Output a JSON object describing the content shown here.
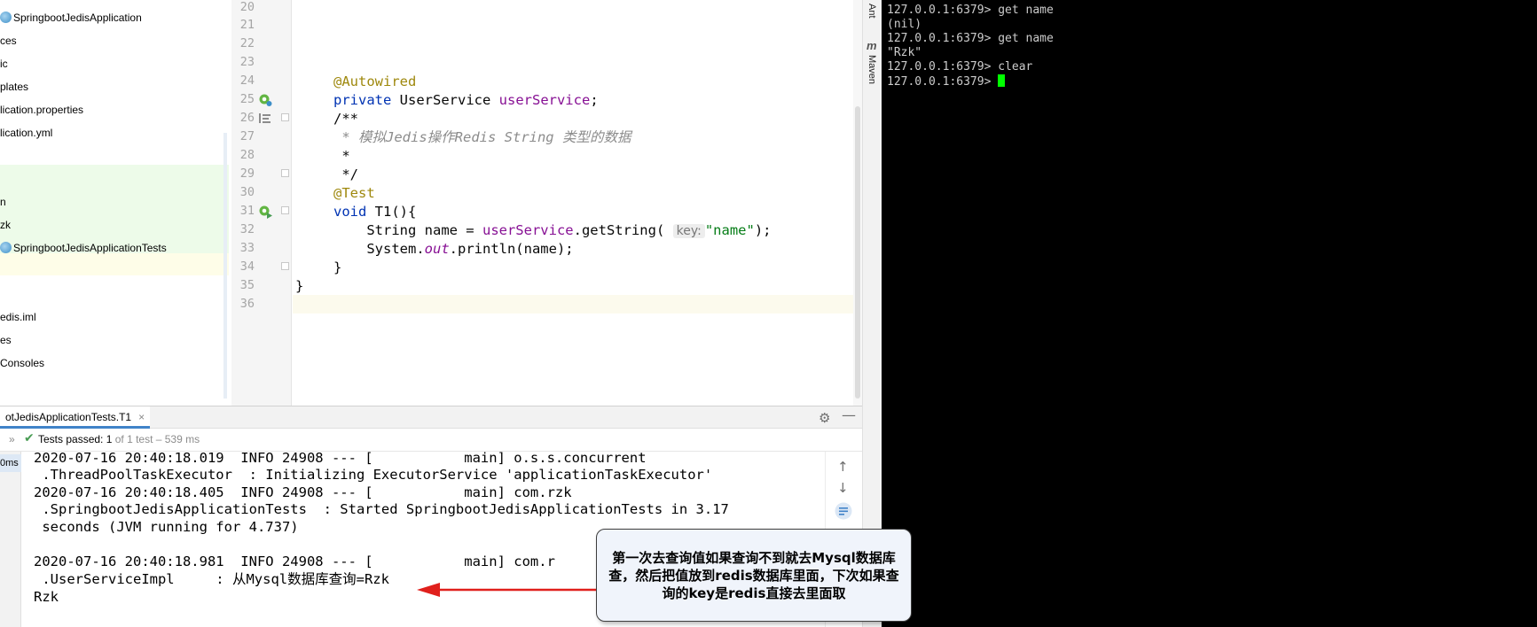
{
  "project_tree": {
    "items": [
      {
        "label": "SpringbootJedisApplication",
        "icon": "spring-class-icon"
      },
      {
        "label": "ces",
        "icon": ""
      },
      {
        "label": "ic",
        "icon": ""
      },
      {
        "label": "plates",
        "icon": ""
      },
      {
        "label": "lication.properties",
        "icon": ""
      },
      {
        "label": "lication.yml",
        "icon": ""
      },
      {
        "label": "",
        "icon": ""
      },
      {
        "label": "",
        "icon": ""
      },
      {
        "label": "n",
        "icon": ""
      },
      {
        "label": "zk",
        "icon": ""
      },
      {
        "label": "SpringbootJedisApplicationTests",
        "icon": "spring-test-class-icon"
      },
      {
        "label": "",
        "icon": ""
      },
      {
        "label": "",
        "icon": ""
      },
      {
        "label": "",
        "icon": ""
      },
      {
        "label": "edis.iml",
        "icon": ""
      },
      {
        "label": "es",
        "icon": ""
      },
      {
        "label": "Consoles",
        "icon": ""
      }
    ]
  },
  "editor": {
    "line_numbers": [
      "20",
      "21",
      "22",
      "23",
      "24",
      "25",
      "26",
      "27",
      "28",
      "29",
      "30",
      "31",
      "32",
      "33",
      "34",
      "35",
      "36"
    ],
    "code": {
      "l24_annotation": "@Autowired",
      "l25_kw": "private",
      "l25_type": " UserService ",
      "l25_field": "userService",
      "l25_end": ";",
      "l26": "/**",
      "l27_star": " * ",
      "l27_text": "模拟Jedis操作Redis String 类型的数据",
      "l28": " *",
      "l29": " */",
      "l30_annotation": "@Test",
      "l31_kw": "void",
      "l31_rest": " T1(){",
      "l32_indent": "    String name = ",
      "l32_field": "userService",
      "l32_call": ".getString( ",
      "l32_hint": "key:",
      "l32_str": "\"name\"",
      "l32_end": ");",
      "l33_a": "    System.",
      "l33_static": "out",
      "l33_b": ".println(name);",
      "l34": "}",
      "l35": "}"
    }
  },
  "tool_strip": {
    "ant_label": "Ant",
    "maven_label": "Maven"
  },
  "terminal": {
    "lines": [
      "127.0.0.1:6379> get name",
      "(nil)",
      "127.0.0.1:6379> get name",
      "\"Rzk\"",
      "127.0.0.1:6379> clear",
      "127.0.0.1:6379> "
    ]
  },
  "run_panel": {
    "tab_label": "otJedisApplicationTests.T1",
    "tab_close": "×",
    "status_main": "Tests passed: 1",
    "status_detail": " of 1 test – 539 ms",
    "left_time": "0ms",
    "console_lines": [
      "2020-07-16 20:40:18.019  INFO 24908 --- [           main] o.s.s.concurrent",
      " .ThreadPoolTaskExecutor  : Initializing ExecutorService 'applicationTaskExecutor'",
      "2020-07-16 20:40:18.405  INFO 24908 --- [           main] com.rzk",
      " .SpringbootJedisApplicationTests  : Started SpringbootJedisApplicationTests in 3.17",
      " seconds (JVM running for 4.737)",
      "",
      "2020-07-16 20:40:18.981  INFO 24908 --- [           main] com.r",
      " .UserServiceImpl     : 从Mysql数据库查询=Rzk",
      "Rzk"
    ]
  },
  "callout": {
    "text": "第一次去查询值如果查询不到就去Mysql数据库查，然后把值放到redis数据库里面，下次如果查询的key是redis直接去里面取"
  },
  "colors": {
    "terminal_bg": "#000000",
    "cursor": "#00ff00",
    "passed_green": "#499c54",
    "annotation_red_arrow": "#e0201c"
  }
}
